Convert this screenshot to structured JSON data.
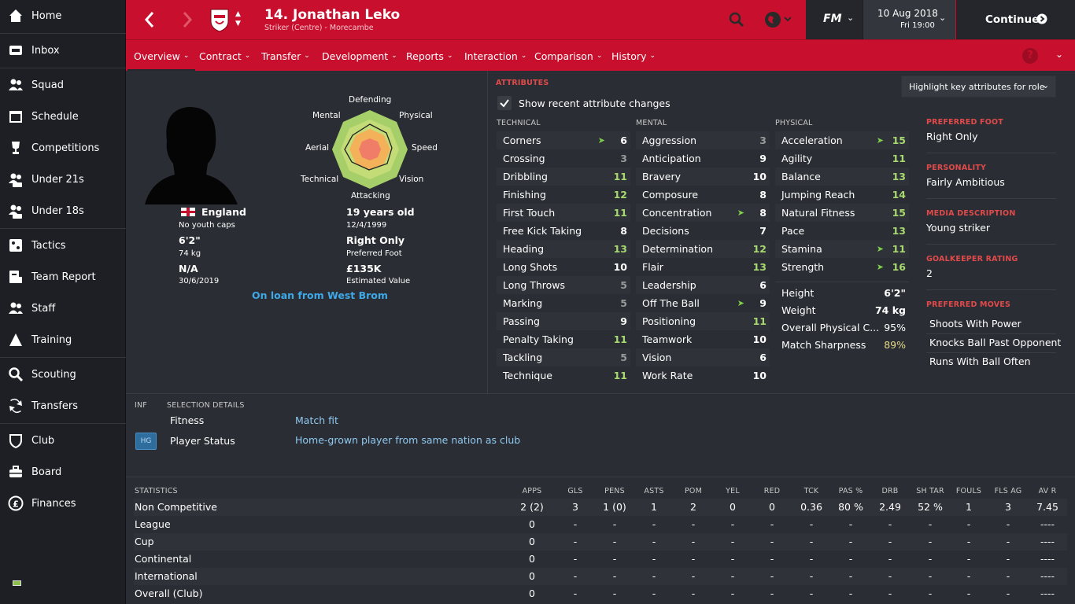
{
  "sidebar": {
    "items": [
      {
        "label": "Home",
        "icon": "home-icon"
      },
      {
        "label": "Inbox",
        "icon": "inbox-icon"
      },
      {
        "label": "Squad",
        "icon": "squad-icon"
      },
      {
        "label": "Schedule",
        "icon": "calendar-icon"
      },
      {
        "label": "Competitions",
        "icon": "trophy-icon"
      },
      {
        "label": "Under 21s",
        "icon": "u21-icon"
      },
      {
        "label": "Under 18s",
        "icon": "u18-icon"
      },
      {
        "label": "Tactics",
        "icon": "tactics-icon"
      },
      {
        "label": "Team Report",
        "icon": "report-icon"
      },
      {
        "label": "Staff",
        "icon": "staff-icon"
      },
      {
        "label": "Training",
        "icon": "training-icon"
      },
      {
        "label": "Scouting",
        "icon": "search-icon"
      },
      {
        "label": "Transfers",
        "icon": "transfers-icon"
      },
      {
        "label": "Club",
        "icon": "club-icon"
      },
      {
        "label": "Board",
        "icon": "board-icon"
      },
      {
        "label": "Finances",
        "icon": "finances-icon"
      }
    ]
  },
  "header": {
    "player_name": "14. Jonathan Leko",
    "player_sub": "Striker (Centre) - Morecambe",
    "date": "10 Aug 2018",
    "time": "Fri 19:00",
    "continue_label": "Continue",
    "fm_label": "FM"
  },
  "tabs": [
    "Overview",
    "Contract",
    "Transfer",
    "Development",
    "Reports",
    "Interaction",
    "Comparison",
    "History"
  ],
  "profile": {
    "nation": "England",
    "youth_caps": "No youth caps",
    "height": "6'2\"",
    "weight": "74 kg",
    "na": "N/A",
    "contract_date": "30/6/2019",
    "age": "19 years old",
    "dob": "12/4/1999",
    "foot": "Right Only",
    "foot_caption": "Preferred Foot",
    "value": "£135K",
    "value_caption": "Estimated Value",
    "loan_text": "On loan from West Brom"
  },
  "radar": {
    "labels": [
      "Defending",
      "Physical",
      "Speed",
      "Vision",
      "Attacking",
      "Technical",
      "Aerial",
      "Mental"
    ]
  },
  "attributes": {
    "title": "ATTRIBUTES",
    "show_changes": "Show recent attribute changes",
    "highlight": "Highlight key attributes for role",
    "technical_hdr": "TECHNICAL",
    "mental_hdr": "MENTAL",
    "physical_hdr": "PHYSICAL",
    "technical": [
      {
        "name": "Corners",
        "value": "6",
        "up": true
      },
      {
        "name": "Crossing",
        "value": "3",
        "up": false
      },
      {
        "name": "Dribbling",
        "value": "11",
        "up": false
      },
      {
        "name": "Finishing",
        "value": "12",
        "up": false
      },
      {
        "name": "First Touch",
        "value": "11",
        "up": false
      },
      {
        "name": "Free Kick Taking",
        "value": "8",
        "up": false
      },
      {
        "name": "Heading",
        "value": "13",
        "up": false
      },
      {
        "name": "Long Shots",
        "value": "10",
        "up": false
      },
      {
        "name": "Long Throws",
        "value": "5",
        "up": false
      },
      {
        "name": "Marking",
        "value": "5",
        "up": false
      },
      {
        "name": "Passing",
        "value": "9",
        "up": false
      },
      {
        "name": "Penalty Taking",
        "value": "11",
        "up": false
      },
      {
        "name": "Tackling",
        "value": "5",
        "up": false
      },
      {
        "name": "Technique",
        "value": "11",
        "up": false
      }
    ],
    "mental": [
      {
        "name": "Aggression",
        "value": "3",
        "up": false
      },
      {
        "name": "Anticipation",
        "value": "9",
        "up": false
      },
      {
        "name": "Bravery",
        "value": "10",
        "up": false
      },
      {
        "name": "Composure",
        "value": "8",
        "up": false
      },
      {
        "name": "Concentration",
        "value": "8",
        "up": true
      },
      {
        "name": "Decisions",
        "value": "7",
        "up": false
      },
      {
        "name": "Determination",
        "value": "12",
        "up": false
      },
      {
        "name": "Flair",
        "value": "13",
        "up": false
      },
      {
        "name": "Leadership",
        "value": "6",
        "up": false
      },
      {
        "name": "Off The Ball",
        "value": "9",
        "up": true
      },
      {
        "name": "Positioning",
        "value": "11",
        "up": false
      },
      {
        "name": "Teamwork",
        "value": "10",
        "up": false
      },
      {
        "name": "Vision",
        "value": "6",
        "up": false
      },
      {
        "name": "Work Rate",
        "value": "10",
        "up": false
      }
    ],
    "physical": [
      {
        "name": "Acceleration",
        "value": "15",
        "up": true
      },
      {
        "name": "Agility",
        "value": "11",
        "up": false
      },
      {
        "name": "Balance",
        "value": "13",
        "up": false
      },
      {
        "name": "Jumping Reach",
        "value": "14",
        "up": false
      },
      {
        "name": "Natural Fitness",
        "value": "15",
        "up": false
      },
      {
        "name": "Pace",
        "value": "13",
        "up": false
      },
      {
        "name": "Stamina",
        "value": "11",
        "up": true
      },
      {
        "name": "Strength",
        "value": "16",
        "up": true
      }
    ],
    "extra": [
      {
        "name": "Height",
        "value": "6'2\""
      },
      {
        "name": "Weight",
        "value": "74 kg"
      },
      {
        "name": "Overall Physical C...",
        "value": "95%"
      },
      {
        "name": "Match Sharpness",
        "value": "89%"
      }
    ]
  },
  "info": {
    "pref_foot_label": "PREFERRED FOOT",
    "pref_foot": "Right Only",
    "personality_label": "PERSONALITY",
    "personality": "Fairly Ambitious",
    "media_label": "MEDIA DESCRIPTION",
    "media": "Young striker",
    "gk_label": "GOALKEEPER RATING",
    "gk": "2",
    "moves_label": "PREFERRED MOVES",
    "moves": [
      "Shoots With Power",
      "Knocks Ball Past Opponent",
      "Runs With Ball Often"
    ]
  },
  "selection": {
    "inf_hdr": "INF",
    "title": "SELECTION DETAILS",
    "fitness_label": "Fitness",
    "fitness_value": "Match fit",
    "status_label": "Player Status",
    "status_value": "Home-grown player from same nation as club",
    "badge": "HG"
  },
  "statistics": {
    "title": "STATISTICS",
    "columns": [
      "APPS",
      "GLS",
      "PENS",
      "ASTS",
      "POM",
      "YEL",
      "RED",
      "TCK",
      "PAS %",
      "DRB",
      "SH TAR",
      "FOULS",
      "FLS AG",
      "AV R"
    ],
    "rows": [
      {
        "label": "Non Competitive",
        "cells": [
          "2 (2)",
          "3",
          "1 (0)",
          "1",
          "2",
          "0",
          "0",
          "0.36",
          "80 %",
          "2.49",
          "52 %",
          "1",
          "3",
          "7.45"
        ]
      },
      {
        "label": "League",
        "cells": [
          "0",
          "-",
          "-",
          "-",
          "-",
          "-",
          "-",
          "-",
          "-",
          "-",
          "-",
          "-",
          "-",
          "----"
        ]
      },
      {
        "label": "Cup",
        "cells": [
          "0",
          "-",
          "-",
          "-",
          "-",
          "-",
          "-",
          "-",
          "-",
          "-",
          "-",
          "-",
          "-",
          "----"
        ]
      },
      {
        "label": "Continental",
        "cells": [
          "0",
          "-",
          "-",
          "-",
          "-",
          "-",
          "-",
          "-",
          "-",
          "-",
          "-",
          "-",
          "-",
          "----"
        ]
      },
      {
        "label": "International",
        "cells": [
          "0",
          "-",
          "-",
          "-",
          "-",
          "-",
          "-",
          "-",
          "-",
          "-",
          "-",
          "-",
          "-",
          "----"
        ]
      },
      {
        "label": "Overall (Club)",
        "cells": [
          "0",
          "-",
          "-",
          "-",
          "-",
          "-",
          "-",
          "-",
          "-",
          "-",
          "-",
          "-",
          "-",
          "----"
        ]
      }
    ]
  },
  "colors": {
    "accent": "#c8102e",
    "green_value": "#a7d96f",
    "link_blue": "#3fa9e8"
  }
}
